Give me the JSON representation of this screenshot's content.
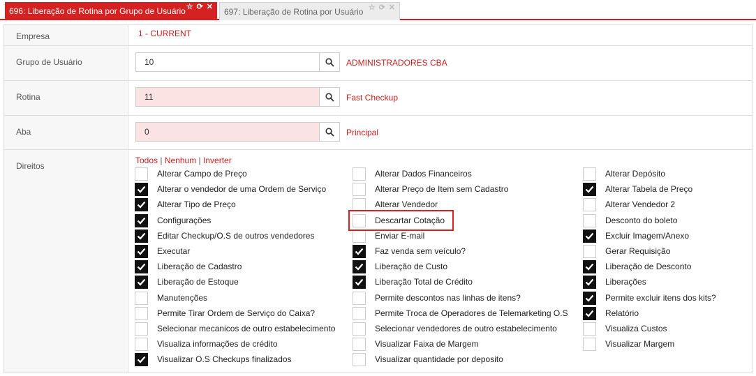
{
  "tabs": [
    {
      "label": "696: Liberação de Rotina por Grupo de Usuário",
      "active": true
    },
    {
      "label": "697: Liberação de Rotina por Usuário",
      "active": false
    }
  ],
  "form": {
    "empresa": {
      "label": "Empresa",
      "value": "1 - CURRENT"
    },
    "grupo": {
      "label": "Grupo de Usuário",
      "value": "10",
      "lookup": "ADMINISTRADORES CBA"
    },
    "rotina": {
      "label": "Rotina",
      "value": "11",
      "lookup": "Fast Checkup"
    },
    "aba": {
      "label": "Aba",
      "value": "0",
      "lookup": "Principal"
    },
    "direitos": {
      "label": "Direitos",
      "links": {
        "todos": "Todos",
        "nenhum": "Nenhum",
        "inverter": "Inverter",
        "sep": "|"
      },
      "items": [
        {
          "label": "Alterar Campo de Preço",
          "checked": false
        },
        {
          "label": "Alterar o vendedor de uma Ordem de Serviço",
          "checked": true
        },
        {
          "label": "Alterar Tipo de Preço",
          "checked": true
        },
        {
          "label": "Configurações",
          "checked": true
        },
        {
          "label": "Editar Checkup/O.S de outros vendedores",
          "checked": true
        },
        {
          "label": "Executar",
          "checked": true
        },
        {
          "label": "Liberação de Cadastro",
          "checked": true
        },
        {
          "label": "Liberação de Estoque",
          "checked": true
        },
        {
          "label": "Manutenções",
          "checked": false
        },
        {
          "label": "Permite Tirar Ordem de Serviço do Caixa?",
          "checked": false
        },
        {
          "label": "Selecionar mecanicos de outro estabelecimento",
          "checked": false
        },
        {
          "label": "Visualiza informações de crédito",
          "checked": false
        },
        {
          "label": "Visualizar O.S Checkups finalizados",
          "checked": true
        },
        {
          "label": "Alterar Dados Financeiros",
          "checked": false
        },
        {
          "label": "Alterar Preço de Item sem Cadastro",
          "checked": false
        },
        {
          "label": "Alterar Vendedor",
          "checked": false
        },
        {
          "label": "Descartar Cotação",
          "checked": false
        },
        {
          "label": "Enviar E-mail",
          "checked": false
        },
        {
          "label": "Faz venda sem veículo?",
          "checked": true
        },
        {
          "label": "Liberação de Custo",
          "checked": true
        },
        {
          "label": "Liberação Total de Crédito",
          "checked": true
        },
        {
          "label": "Permite descontos nas linhas de itens?",
          "checked": false
        },
        {
          "label": "Permite Troca de Operadores de Telemarketing O.S",
          "checked": false
        },
        {
          "label": "Selecionar vendedores de outro estabelecimento",
          "checked": false
        },
        {
          "label": "Visualizar Faixa de Margem",
          "checked": false
        },
        {
          "label": "Visualizar quantidade por deposito",
          "checked": false
        },
        {
          "label": "Alterar Depósito",
          "checked": false
        },
        {
          "label": "Alterar Tabela de Preço",
          "checked": true
        },
        {
          "label": "Alterar Vendedor 2",
          "checked": false
        },
        {
          "label": "Desconto do boleto",
          "checked": false
        },
        {
          "label": "Excluir Imagem/Anexo",
          "checked": true
        },
        {
          "label": "Gerar Requisição",
          "checked": false
        },
        {
          "label": "Liberação de Desconto",
          "checked": true
        },
        {
          "label": "Liberações",
          "checked": true
        },
        {
          "label": "Permite excluir itens dos kits?",
          "checked": true
        },
        {
          "label": "Relatório",
          "checked": true
        },
        {
          "label": "Visualiza Custos",
          "checked": false
        },
        {
          "label": "Visualizar Margem",
          "checked": false
        }
      ]
    }
  },
  "colors": {
    "accent": "#d42121",
    "error_input_bg": "#fbe3e3",
    "highlight": "#e02020"
  }
}
